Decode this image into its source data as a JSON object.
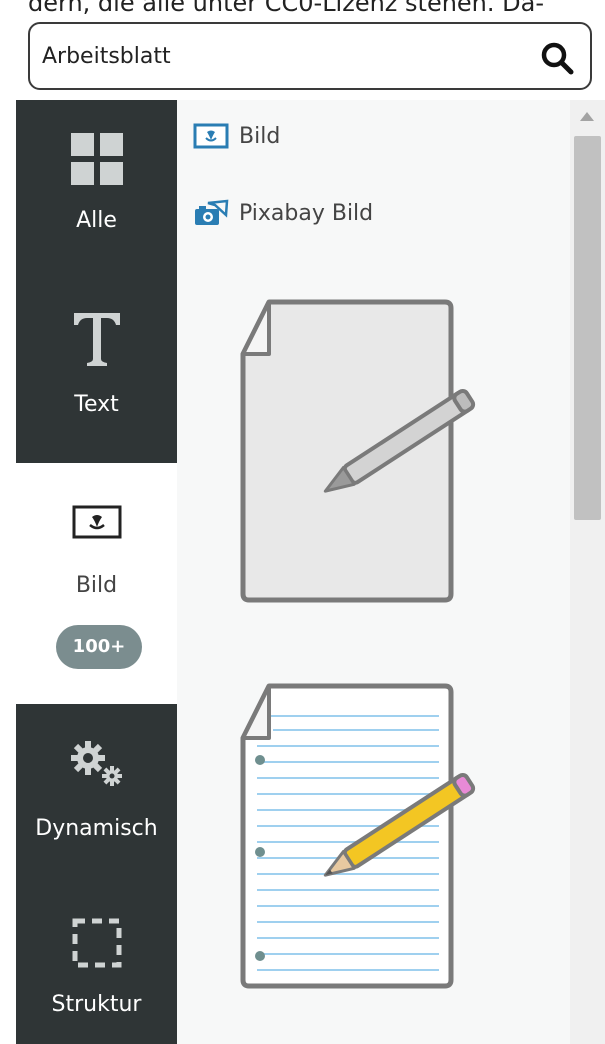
{
  "background": {
    "partial_text": "dern, die alle unter CC0-Lizenz stehen. Da-"
  },
  "search": {
    "value": "Arbeitsblatt",
    "icon": "search-icon"
  },
  "sidebar": {
    "categories": [
      {
        "label": "Alle",
        "icon": "grid-icon",
        "active": false
      },
      {
        "label": "Text",
        "icon": "text-icon",
        "active": false
      },
      {
        "label": "Bild",
        "icon": "image-icon",
        "active": true,
        "badge": "100+"
      },
      {
        "label": "Dynamisch",
        "icon": "gears-icon",
        "active": false
      },
      {
        "label": "Struktur",
        "icon": "structure-icon",
        "active": false
      }
    ]
  },
  "results": {
    "items": [
      {
        "label": "Bild",
        "icon": "image-icon"
      },
      {
        "label": "Pixabay Bild",
        "icon": "camera-icon"
      }
    ],
    "thumbnails": [
      {
        "name": "worksheet-blank-pencil"
      },
      {
        "name": "worksheet-lined-pencil"
      }
    ]
  },
  "colors": {
    "sidebar_dark": "#2f3536",
    "badge": "#7b8d8f",
    "accent_blue": "#2a7db3",
    "pencil_yellow": "#f3c623"
  }
}
